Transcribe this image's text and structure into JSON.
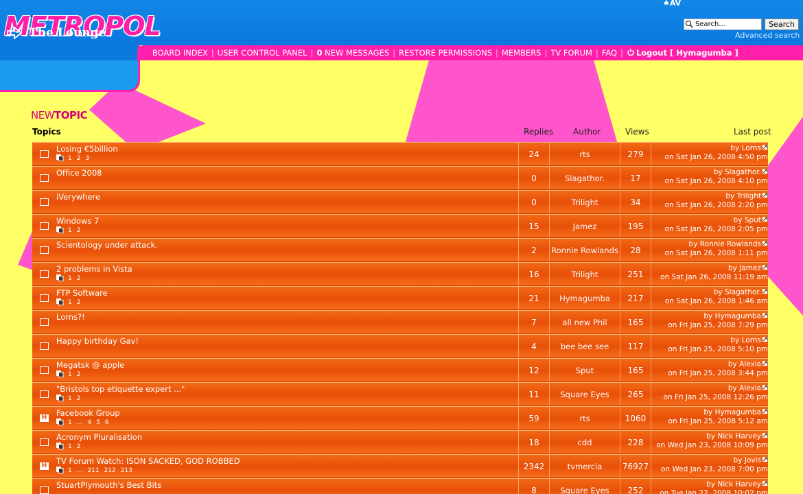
{
  "header": {
    "logo_text": "METROPOL",
    "top_glyph": "♠AV",
    "search_placeholder": "Search...",
    "search_button": "Search",
    "advanced_search": "Advanced search"
  },
  "nav": {
    "board_index": "BOARD INDEX",
    "ucp": "USER CONTROL PANEL",
    "new_msg_count": "0",
    "new_messages": "NEW MESSAGES",
    "restore": "RESTORE PERMISSIONS",
    "members": "MEMBERS",
    "tv_forum": "TV FORUM",
    "faq": "FAQ",
    "logout": "Logout [ Hymagumba ]"
  },
  "forum": {
    "title": "The Lounge",
    "new_topic_a": "NEW",
    "new_topic_b": "TOPIC"
  },
  "columns": {
    "topics": "Topics",
    "replies": "Replies",
    "author": "Author",
    "views": "Views",
    "last_post": "Last post"
  },
  "colors": {
    "background": "#ffff66",
    "header_blue": "#0a78dd",
    "nav_pink": "#ff1faa",
    "row_orange": "#e84f08"
  },
  "topics": [
    {
      "title": "Losing €5billion",
      "pages": [
        "1",
        "2",
        "3"
      ],
      "replies": "24",
      "author": "rts",
      "views": "279",
      "last_by": "by Lorns",
      "last_on": "on Sat Jan 26, 2008 4:50 pm",
      "icon": "",
      "hot": false
    },
    {
      "title": "Office 2008",
      "pages": [],
      "replies": "0",
      "author": "Slagathor.",
      "views": "17",
      "last_by": "by Slagathor.",
      "last_on": "on Sat Jan 26, 2008 4:10 pm",
      "icon": "",
      "hot": false
    },
    {
      "title": "iVerywhere",
      "pages": [],
      "replies": "0",
      "author": "Trilight",
      "views": "34",
      "last_by": "by Trilight",
      "last_on": "on Sat Jan 26, 2008 2:20 pm",
      "icon": "",
      "hot": false
    },
    {
      "title": "Windows 7",
      "pages": [
        "1",
        "2"
      ],
      "replies": "15",
      "author": "Jamez",
      "views": "195",
      "last_by": "by Sput",
      "last_on": "on Sat Jan 26, 2008 2:05 pm",
      "icon": "",
      "hot": false
    },
    {
      "title": "Scientology under attack.",
      "pages": [],
      "replies": "2",
      "author": "Ronnie Rowlands",
      "views": "28",
      "last_by": "by Ronnie Rowlands",
      "last_on": "on Sat Jan 26, 2008 1:11 pm",
      "icon": "",
      "hot": false
    },
    {
      "title": "2 problems in Vista",
      "pages": [
        "1",
        "2"
      ],
      "replies": "16",
      "author": "Trilight",
      "views": "251",
      "last_by": "by Jamez",
      "last_on": "on Sat Jan 26, 2008 11:19 am",
      "icon": "",
      "hot": false
    },
    {
      "title": "FTP Software",
      "pages": [
        "1",
        "2"
      ],
      "replies": "21",
      "author": "Hymagumba",
      "views": "217",
      "last_by": "by Slagathor.",
      "last_on": "on Sat Jan 26, 2008 1:46 am",
      "icon": "",
      "hot": false
    },
    {
      "title": "Lorns?!",
      "pages": [],
      "replies": "7",
      "author": "all new Phil",
      "views": "165",
      "last_by": "by Hymagumba",
      "last_on": "on Fri Jan 25, 2008 7:29 pm",
      "icon": "",
      "hot": false
    },
    {
      "title": "Happy birthday Gav!",
      "pages": [],
      "replies": "4",
      "author": "bee bee see",
      "views": "117",
      "last_by": "by Lorns",
      "last_on": "on Fri Jan 25, 2008 5:10 pm",
      "icon": "",
      "hot": false
    },
    {
      "title": "Megatsk @ apple",
      "pages": [
        "1",
        "2"
      ],
      "replies": "12",
      "author": "Sput",
      "views": "165",
      "last_by": "by Alexia",
      "last_on": "on Fri Jan 25, 2008 3:44 pm",
      "icon": "",
      "hot": false
    },
    {
      "title": "\"Bristols top etiquette expert ...\"",
      "pages": [
        "1",
        "2"
      ],
      "replies": "11",
      "author": "Square Eyes",
      "views": "265",
      "last_by": "by Alexia",
      "last_on": "on Fri Jan 25, 2008 12:26 pm",
      "icon": "",
      "hot": false
    },
    {
      "title": "Facebook Group",
      "pages": [
        "1",
        "...",
        "4",
        "5",
        "6"
      ],
      "replies": "59",
      "author": "rts",
      "views": "1060",
      "last_by": "by Hymagumba",
      "last_on": "on Fri Jan 25, 2008 5:12 am",
      "icon": "H",
      "hot": true
    },
    {
      "title": "Acronym Pluralisation",
      "pages": [
        "1",
        "2"
      ],
      "replies": "18",
      "author": "cdd",
      "views": "228",
      "last_by": "by Nick Harvey",
      "last_on": "on Wed Jan 23, 2008 10:09 pm",
      "icon": "",
      "hot": false
    },
    {
      "title": "TV Forum Watch: ISON SACKED, GOD ROBBED",
      "pages": [
        "1",
        "...",
        "211",
        "212",
        "213"
      ],
      "replies": "2342",
      "author": "tvmercia",
      "views": "76927",
      "last_by": "by Jovis",
      "last_on": "on Wed Jan 23, 2008 7:00 pm",
      "icon": "H",
      "hot": true
    },
    {
      "title": "StuartPlymouth's Best Bits",
      "pages": [],
      "replies": "8",
      "author": "Square Eyes",
      "views": "252",
      "last_by": "by Nick Harvey",
      "last_on": "on Tue Jan 22, 2008 10:02 pm",
      "icon": "",
      "hot": false
    }
  ]
}
